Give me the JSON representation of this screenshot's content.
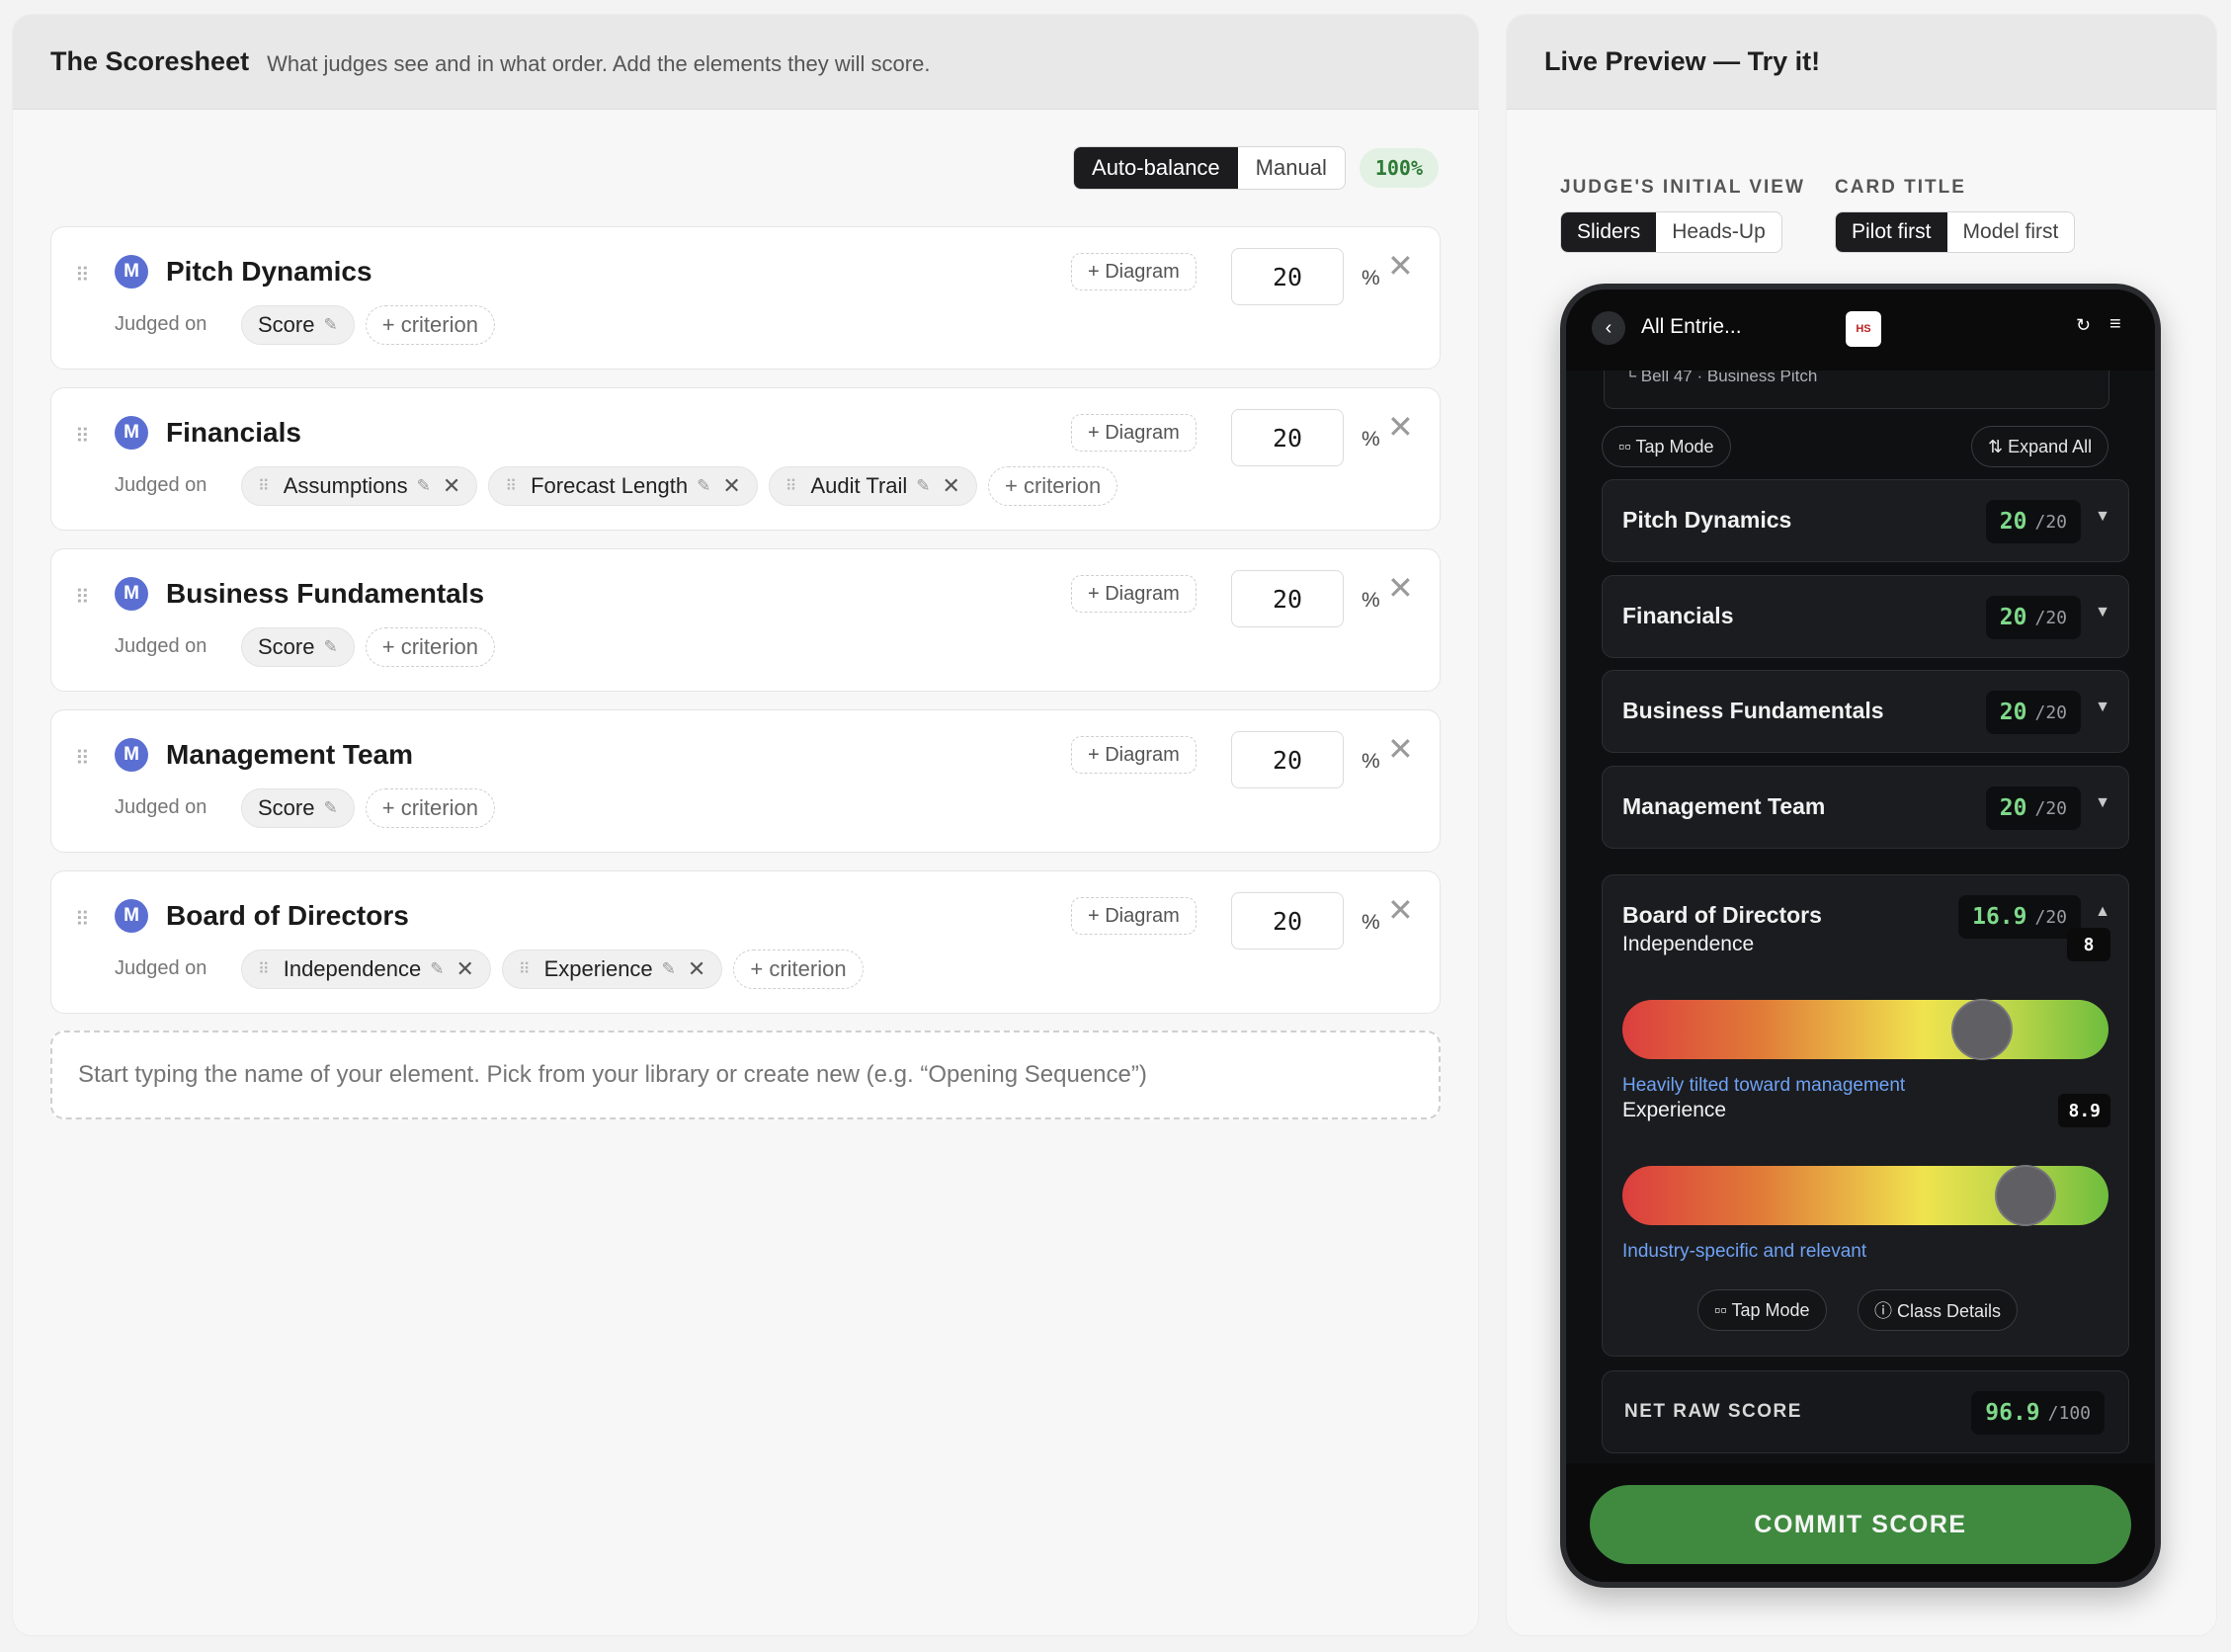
{
  "builder": {
    "title": "The Scoresheet",
    "subtitle": "What judges see and in what order. Add the elements they will score.",
    "mode_auto": "Auto-balance",
    "mode_manual": "Manual",
    "total_pct": "100%",
    "judged_on_label": "Judged on",
    "add_criterion": "+ criterion",
    "diagram_btn": "+ Diagram",
    "pct_sign": "%",
    "element_badge": "M",
    "elements": [
      {
        "name": "Pitch Dynamics",
        "weight": "20",
        "criteria": [
          "Score"
        ]
      },
      {
        "name": "Financials",
        "weight": "20",
        "criteria": [
          "Assumptions",
          "Forecast Length",
          "Audit Trail"
        ]
      },
      {
        "name": "Business Fundamentals",
        "weight": "20",
        "criteria": [
          "Score"
        ]
      },
      {
        "name": "Management Team",
        "weight": "20",
        "criteria": [
          "Score"
        ]
      },
      {
        "name": "Board of Directors",
        "weight": "20",
        "criteria": [
          "Independence",
          "Experience"
        ]
      }
    ],
    "add_element_placeholder": "Start typing the name of your element. Pick from your library or create new (e.g. “Opening Sequence”)"
  },
  "preview": {
    "title": "Live Preview — Try it!",
    "initial_view_label": "JUDGE'S INITIAL VIEW",
    "initial_view_options": [
      "Sliders",
      "Heads-Up"
    ],
    "initial_view_selected": "Sliders",
    "card_title_label": "CARD TITLE",
    "card_title_options": [
      "Pilot first",
      "Model first"
    ],
    "card_title_selected": "Pilot first",
    "phone": {
      "nav_title": "All Entrie...",
      "logo_text": "HS",
      "entry_sub": "└ Bell 47 · Business Pitch",
      "tap_mode": "▫▫ Tap Mode",
      "expand_all": "⇅ Expand All",
      "elements": [
        {
          "name": "Pitch Dynamics",
          "score": "20",
          "max": "/20"
        },
        {
          "name": "Financials",
          "score": "20",
          "max": "/20"
        },
        {
          "name": "Business Fundamentals",
          "score": "20",
          "max": "/20"
        },
        {
          "name": "Management Team",
          "score": "20",
          "max": "/20"
        }
      ],
      "expanded": {
        "name": "Board of Directors",
        "score": "16.9",
        "max": "/20",
        "criteria": [
          {
            "name": "Independence",
            "value": "8",
            "level": 0.74,
            "desc": "Heavily tilted toward management"
          },
          {
            "name": "Experience",
            "value": "8.9",
            "level": 0.83,
            "desc": "Industry-specific and relevant"
          }
        ],
        "tap_mode": "▫▫ Tap Mode",
        "class_details": "ⓘ Class Details"
      },
      "net_label": "NET RAW SCORE",
      "net_score": "96.9",
      "net_max": "/100",
      "commit": "COMMIT SCORE"
    }
  }
}
